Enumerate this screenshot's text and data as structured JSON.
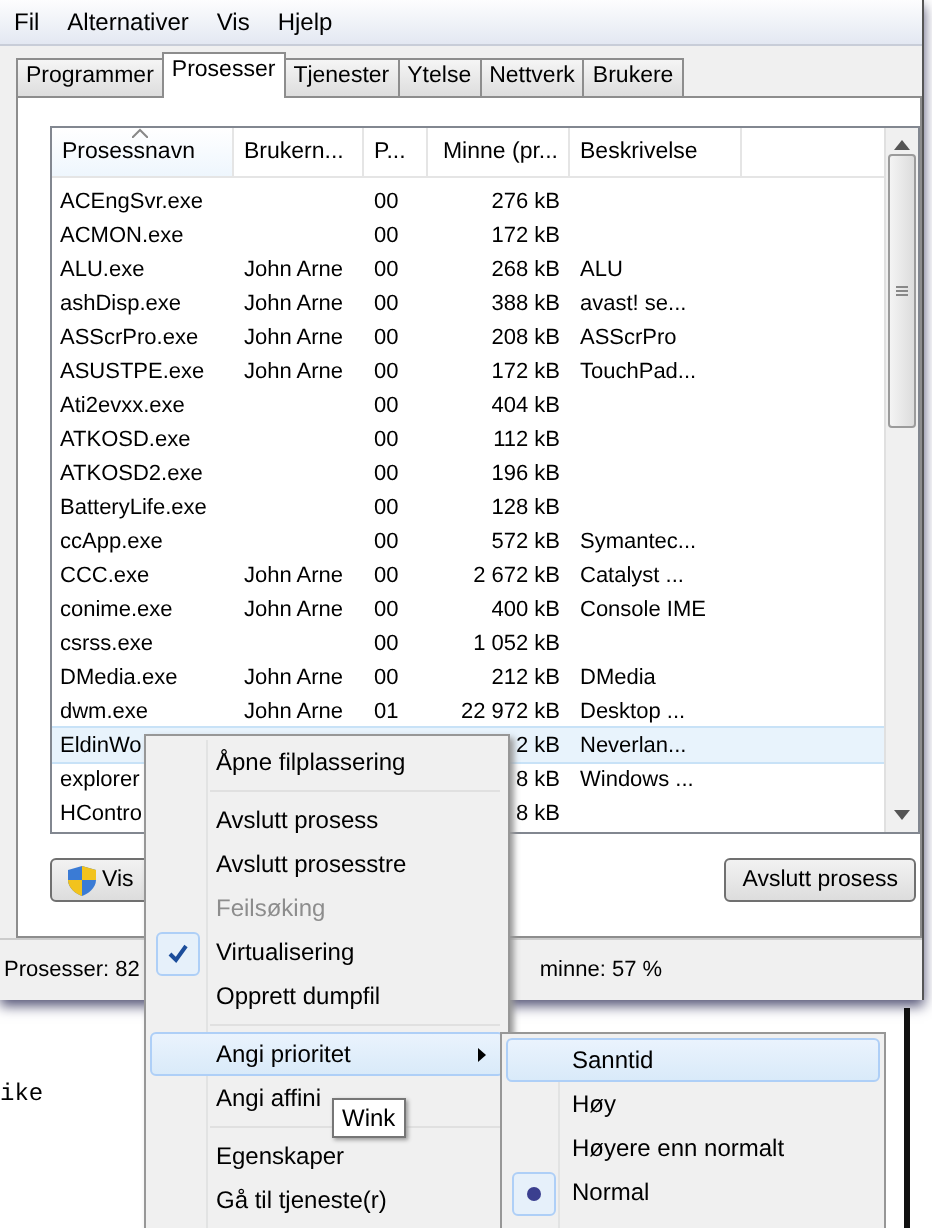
{
  "menu_bar": [
    "Fil",
    "Alternativer",
    "Vis",
    "Hjelp"
  ],
  "tabs": [
    {
      "label": "Programmer",
      "selected": false
    },
    {
      "label": "Prosesser",
      "selected": true
    },
    {
      "label": "Tjenester",
      "selected": false
    },
    {
      "label": "Ytelse",
      "selected": false
    },
    {
      "label": "Nettverk",
      "selected": false
    },
    {
      "label": "Brukere",
      "selected": false
    }
  ],
  "table": {
    "columns": [
      "Prosessnavn",
      "Brukern...",
      "P...",
      "Minne (pr...",
      "Beskrivelse"
    ],
    "rows": [
      {
        "cells": [
          "ACEngSvr.exe",
          "",
          "00",
          "276 kB",
          ""
        ],
        "selected": false
      },
      {
        "cells": [
          "ACMON.exe",
          "",
          "00",
          "172 kB",
          ""
        ],
        "selected": false
      },
      {
        "cells": [
          "ALU.exe",
          "John Arne",
          "00",
          "268 kB",
          "ALU"
        ],
        "selected": false
      },
      {
        "cells": [
          "ashDisp.exe",
          "John Arne",
          "00",
          "388 kB",
          "avast! se..."
        ],
        "selected": false
      },
      {
        "cells": [
          "ASScrPro.exe",
          "John Arne",
          "00",
          "208 kB",
          "ASScrPro"
        ],
        "selected": false
      },
      {
        "cells": [
          "ASUSTPE.exe",
          "John Arne",
          "00",
          "172 kB",
          "TouchPad..."
        ],
        "selected": false
      },
      {
        "cells": [
          "Ati2evxx.exe",
          "",
          "00",
          "404 kB",
          ""
        ],
        "selected": false
      },
      {
        "cells": [
          "ATKOSD.exe",
          "",
          "00",
          "112 kB",
          ""
        ],
        "selected": false
      },
      {
        "cells": [
          "ATKOSD2.exe",
          "",
          "00",
          "196 kB",
          ""
        ],
        "selected": false
      },
      {
        "cells": [
          "BatteryLife.exe",
          "",
          "00",
          "128 kB",
          ""
        ],
        "selected": false
      },
      {
        "cells": [
          "ccApp.exe",
          "",
          "00",
          "572 kB",
          "Symantec..."
        ],
        "selected": false
      },
      {
        "cells": [
          "CCC.exe",
          "John Arne",
          "00",
          "2 672 kB",
          "Catalyst ..."
        ],
        "selected": false
      },
      {
        "cells": [
          "conime.exe",
          "John Arne",
          "00",
          "400 kB",
          "Console IME"
        ],
        "selected": false
      },
      {
        "cells": [
          "csrss.exe",
          "",
          "00",
          "1 052 kB",
          ""
        ],
        "selected": false
      },
      {
        "cells": [
          "DMedia.exe",
          "John Arne",
          "00",
          "212 kB",
          "DMedia"
        ],
        "selected": false
      },
      {
        "cells": [
          "dwm.exe",
          "John Arne",
          "01",
          "22 972 kB",
          "Desktop ..."
        ],
        "selected": false
      },
      {
        "cells": [
          "EldinWo",
          "",
          "",
          "2 kB",
          "Neverlan..."
        ],
        "selected": true
      },
      {
        "cells": [
          "explorer",
          "",
          "",
          "8 kB",
          "Windows ..."
        ],
        "selected": false
      },
      {
        "cells": [
          "HContro",
          "",
          "",
          "8 kB",
          ""
        ],
        "selected": false
      }
    ]
  },
  "buttons": [
    {
      "label": "Vis"
    },
    {
      "label": "Avslutt prosess"
    }
  ],
  "status_bar": [
    "Prosesser: 82",
    "minne: 57 %"
  ],
  "background_text": "ike",
  "context_menu": [
    {
      "kind": "item",
      "label": "Åpne filplassering",
      "disabled": false,
      "checked": false,
      "highlighted": false
    },
    {
      "kind": "separator"
    },
    {
      "kind": "item",
      "label": "Avslutt prosess",
      "disabled": false,
      "checked": false,
      "highlighted": false
    },
    {
      "kind": "item",
      "label": "Avslutt prosesstre",
      "disabled": false,
      "checked": false,
      "highlighted": false
    },
    {
      "kind": "item",
      "label": "Feilsøking",
      "disabled": true,
      "checked": false,
      "highlighted": false
    },
    {
      "kind": "item",
      "label": "Virtualisering",
      "disabled": false,
      "checked": true,
      "highlighted": false
    },
    {
      "kind": "item",
      "label": "Opprett dumpfil",
      "disabled": false,
      "checked": false,
      "highlighted": false
    },
    {
      "kind": "separator"
    },
    {
      "kind": "submenu",
      "label": "Angi prioritet",
      "disabled": false,
      "checked": false,
      "highlighted": true
    },
    {
      "kind": "item",
      "label": "Angi affini",
      "disabled": false,
      "checked": false,
      "highlighted": false
    },
    {
      "kind": "separator"
    },
    {
      "kind": "item",
      "label": "Egenskaper",
      "disabled": false,
      "checked": false,
      "highlighted": false
    },
    {
      "kind": "item",
      "label": "Gå til tjeneste(r)",
      "disabled": false,
      "checked": false,
      "highlighted": false
    }
  ],
  "tooltip": "Wink",
  "priority_submenu": [
    {
      "label": "Sanntid",
      "selected": false,
      "highlighted": true
    },
    {
      "label": "Høy",
      "selected": false,
      "highlighted": false
    },
    {
      "label": "Høyere enn normalt",
      "selected": false,
      "highlighted": false
    },
    {
      "label": "Normal",
      "selected": true,
      "highlighted": false
    }
  ]
}
